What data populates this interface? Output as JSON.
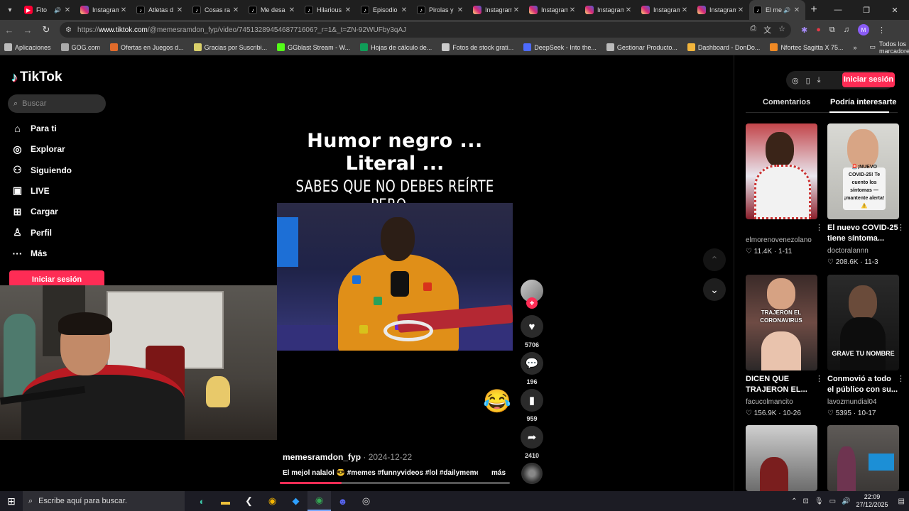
{
  "browser": {
    "tabs": [
      {
        "title": "Fito",
        "favicon": "youtube-icon",
        "audio": true,
        "active": false
      },
      {
        "title": "Instagram",
        "favicon": "instagram-icon",
        "audio": false,
        "active": false
      },
      {
        "title": "Atletas d",
        "favicon": "tiktok-icon",
        "audio": false,
        "active": false
      },
      {
        "title": "Cosas ra",
        "favicon": "tiktok-icon",
        "audio": false,
        "active": false
      },
      {
        "title": "Me desa",
        "favicon": "tiktok-icon",
        "audio": false,
        "active": false
      },
      {
        "title": "Hilarious",
        "favicon": "tiktok-icon",
        "audio": false,
        "active": false
      },
      {
        "title": "Episodio",
        "favicon": "tiktok-icon",
        "audio": false,
        "active": false
      },
      {
        "title": "Pirolas y",
        "favicon": "tiktok-icon",
        "audio": false,
        "active": false
      },
      {
        "title": "Instagram",
        "favicon": "instagram-icon",
        "audio": false,
        "active": false
      },
      {
        "title": "Instagram",
        "favicon": "instagram-icon",
        "audio": false,
        "active": false
      },
      {
        "title": "Instagram",
        "favicon": "instagram-icon",
        "audio": false,
        "active": false
      },
      {
        "title": "Instagram",
        "favicon": "instagram-icon",
        "audio": false,
        "active": false
      },
      {
        "title": "Instagram",
        "favicon": "instagram-icon",
        "audio": false,
        "active": false
      },
      {
        "title": "El me",
        "favicon": "tiktok-icon",
        "audio": true,
        "active": true
      }
    ],
    "url_prefix": "https://",
    "url_host": "www.tiktok.com",
    "url_path": "/@memesramdon_fyp/video/7451328945468771606?_r=1&_t=ZN-92WUFby3qAJ",
    "profile_initial": "M",
    "bookmarks": [
      {
        "label": "Aplicaciones",
        "icon": "apps-grid-icon",
        "color": "#bbbbbb"
      },
      {
        "label": "GOG.com",
        "icon": "gog-icon",
        "color": "#aaaaaa"
      },
      {
        "label": "Ofertas en Juegos d...",
        "icon": "tag-icon",
        "color": "#e06b2b"
      },
      {
        "label": "Gracias por Suscribi...",
        "icon": "wave-icon",
        "color": "#d9d06a"
      },
      {
        "label": "GGblast Stream - W...",
        "icon": "k-icon",
        "color": "#53fc18"
      },
      {
        "label": "Hojas de cálculo de...",
        "icon": "sheets-icon",
        "color": "#0f9d58"
      },
      {
        "label": "Fotos de stock grati...",
        "icon": "camera-icon",
        "color": "#cccccc"
      },
      {
        "label": "DeepSeek - Into the...",
        "icon": "whale-icon",
        "color": "#4d6bfe"
      },
      {
        "label": "Gestionar Producto...",
        "icon": "cloud-icon",
        "color": "#bbbbbb"
      },
      {
        "label": "Dashboard - DonDo...",
        "icon": "folder-icon",
        "color": "#f2b53c"
      },
      {
        "label": "Nfortec Sagitta X 75...",
        "icon": "fox-icon",
        "color": "#f08a24"
      }
    ],
    "all_bookmarks": "Todos los marcadores"
  },
  "sidebar": {
    "logo": "TikTok",
    "search_placeholder": "Buscar",
    "nav": [
      {
        "label": "Para ti",
        "icon": "home-icon"
      },
      {
        "label": "Explorar",
        "icon": "compass-icon"
      },
      {
        "label": "Siguiendo",
        "icon": "following-icon"
      },
      {
        "label": "LIVE",
        "icon": "live-icon"
      },
      {
        "label": "Cargar",
        "icon": "upload-icon"
      },
      {
        "label": "Perfil",
        "icon": "profile-icon"
      },
      {
        "label": "Más",
        "icon": "more-icon"
      }
    ],
    "login_label": "Iniciar sesión"
  },
  "video": {
    "caption_line1": "Humor negro ...",
    "caption_line2": "Literal ...",
    "caption_line3": "SABES QUE NO DEBES REÍRTE  PERO...",
    "author": "memesramdon_fyp",
    "date": "2024-12-22",
    "description": "El mejol nalalol 😎 #memes #funnyvideos #lol #dailymemes ...",
    "more_label": "más",
    "progress": 0.27,
    "likes": "5706",
    "comments": "196",
    "saves": "959",
    "shares": "2410"
  },
  "right_panel": {
    "login_label": "Iniciar sesión",
    "tab_comments": "Comentarios",
    "tab_interesting": "Podría interesarte",
    "cards": [
      {
        "title": "",
        "author": "elmorenovenezolano",
        "likes": "11.4K",
        "date": "1-11",
        "thumb_text": ""
      },
      {
        "title": "El nuevo COVID-25 tiene síntoma...",
        "author": "doctoralannn",
        "likes": "208.6K",
        "date": "11-3",
        "thumb_text": "🚨¡NUEVO COVID-25! Te cuento los síntomas — ¡mantente alerta! ⚠️"
      },
      {
        "title": "DICEN QUE TRAJERON EL...",
        "author": "facucolmancito",
        "likes": "156.9K",
        "date": "10-26",
        "thumb_text": "TRAJERON EL CORONAVIRUS"
      },
      {
        "title": "Conmovió a todo el público con su...",
        "author": "lavozmundial04",
        "likes": "5395",
        "date": "10-17",
        "thumb_text": "GRAVE TU NOMBRE"
      }
    ]
  },
  "taskbar": {
    "search_placeholder": "Escribe aquí para buscar.",
    "time": "22:09",
    "date": "27/12/2025"
  }
}
